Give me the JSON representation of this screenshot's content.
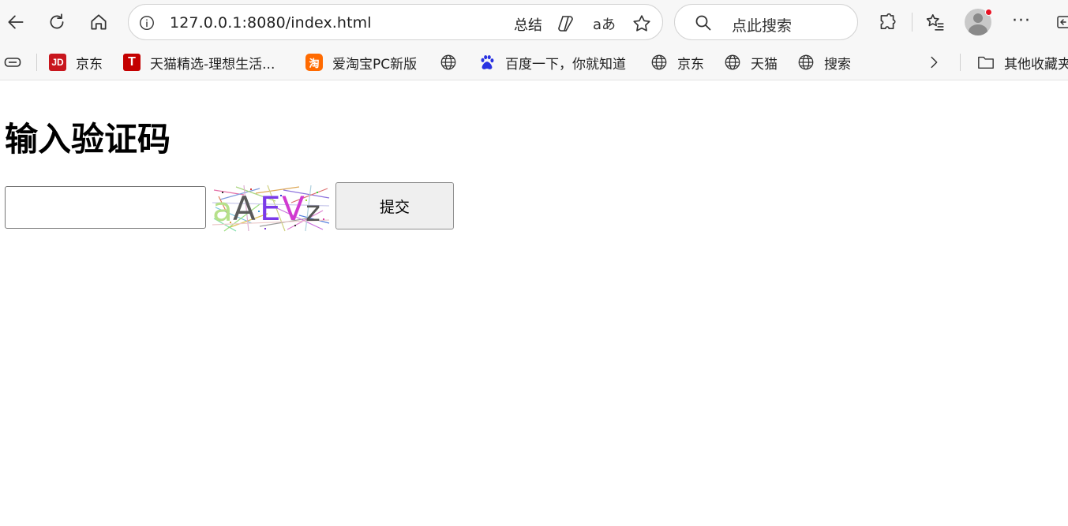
{
  "browser": {
    "url": "127.0.0.1:8080/index.html",
    "summary_label": "总结",
    "reader_label": "aあ",
    "search_placeholder": "点此搜索",
    "more_label": "···"
  },
  "bookmarks": {
    "items": [
      {
        "label": "京东",
        "icon": "jd-icon"
      },
      {
        "label": "天猫精选-理想生活...",
        "icon": "tmall-icon"
      },
      {
        "label": "爱淘宝PC新版",
        "icon": "taobao-icon"
      },
      {
        "label": "",
        "icon": "globe-icon"
      },
      {
        "label": "百度一下，你就知道",
        "icon": "baidu-icon"
      },
      {
        "label": "京东",
        "icon": "globe-icon"
      },
      {
        "label": "天猫",
        "icon": "globe-icon"
      },
      {
        "label": "搜索",
        "icon": "globe-icon"
      }
    ],
    "other_folder": "其他收藏夹",
    "jd_logo_text": "JD",
    "tmall_logo_text": "T",
    "taobao_logo_text": "淘"
  },
  "page": {
    "title": "输入验证码",
    "input_value": "",
    "captcha_text": "aAEVz",
    "submit_label": "提交"
  },
  "colors": {
    "toolbar_bg": "#f7f7f7",
    "jd_red": "#c8161d",
    "tmall_red": "#c40000",
    "taobao_orange": "#ff6a00",
    "baidu_blue": "#2932e1",
    "notification_dot": "#e81123"
  }
}
